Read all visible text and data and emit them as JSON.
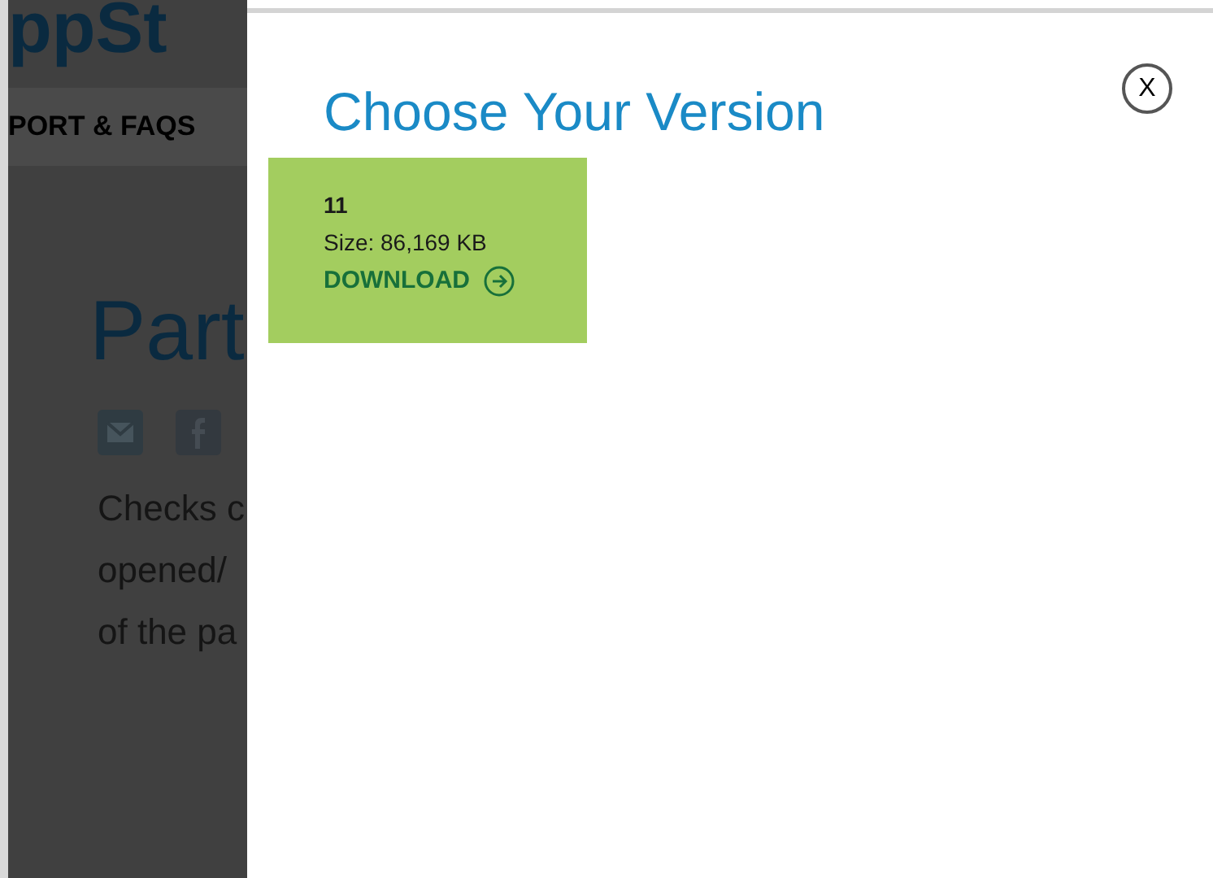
{
  "background_page": {
    "logo": "ppSt",
    "nav_item": "PORT & FAQS",
    "heading": "Part",
    "paragraph_lines": [
      "Checks c",
      "opened/",
      "of the pa"
    ]
  },
  "modal": {
    "title": "Choose Your Version",
    "close": "X",
    "versions": [
      {
        "version": "11",
        "size": "Size: 86,169 KB",
        "action": "DOWNLOAD"
      }
    ]
  }
}
